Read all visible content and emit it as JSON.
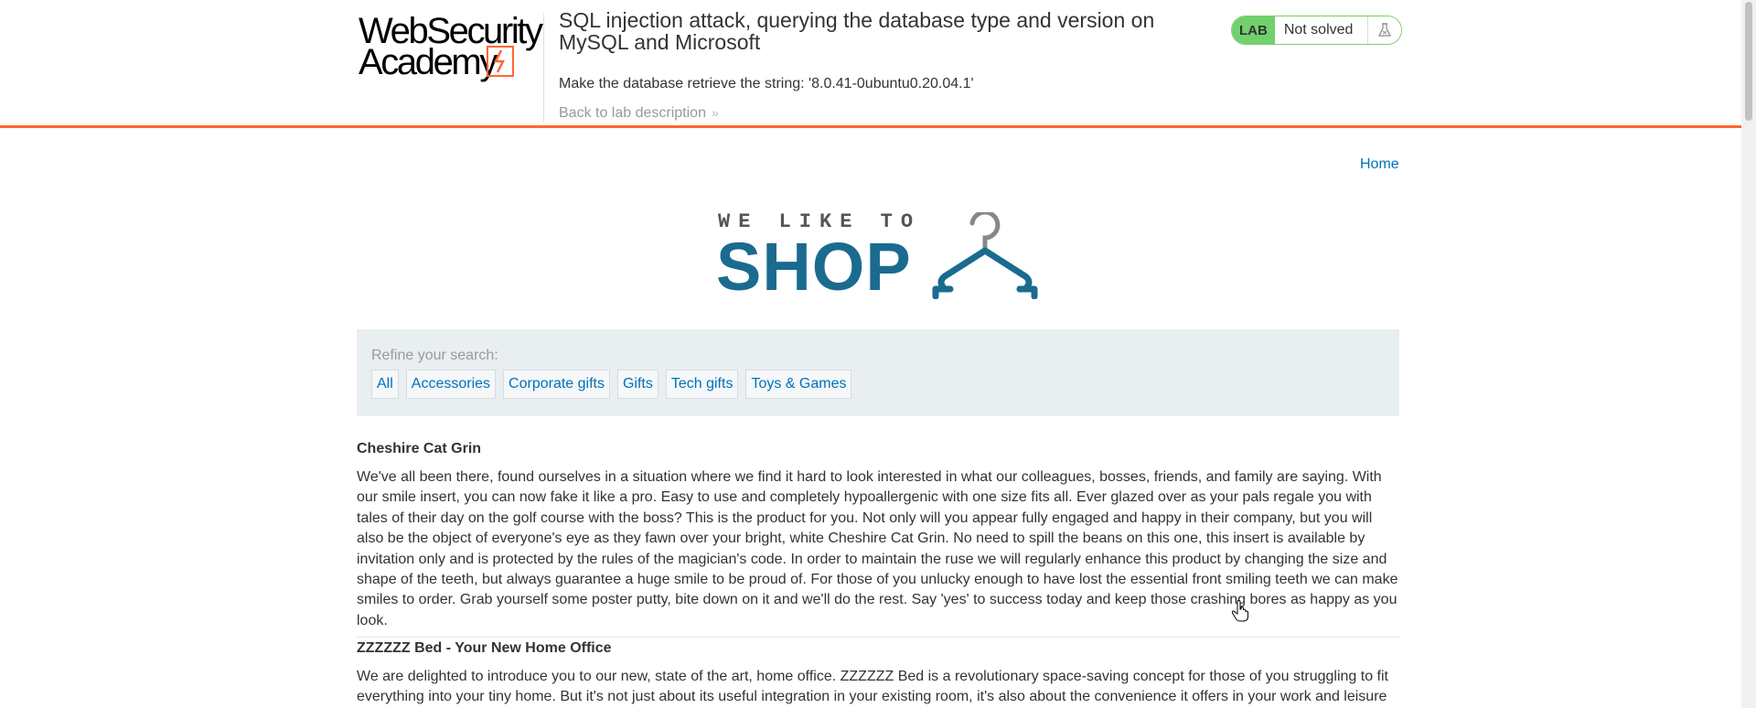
{
  "header": {
    "logo_line1": "WebSecurity",
    "logo_line2": "Academy",
    "lab_title": "SQL injection attack, querying the database type and version on MySQL and Microsoft",
    "lab_subtitle": "Make the database retrieve the string: '8.0.41-0ubuntu0.20.04.1'",
    "back_link": "Back to lab description",
    "status_badge": "LAB",
    "status_text": "Not solved",
    "colors": {
      "accent": "#ff6633",
      "badge": "#70d16d"
    }
  },
  "nav": {
    "home": "Home"
  },
  "shop_logo": {
    "tagline": "WE LIKE TO",
    "word": "SHOP"
  },
  "filters": {
    "label": "Refine your search:",
    "items": [
      "All",
      "Accessories",
      "Corporate gifts",
      "Gifts",
      "Tech gifts",
      "Toys & Games"
    ]
  },
  "products": [
    {
      "title": "Cheshire Cat Grin",
      "description": "We've all been there, found ourselves in a situation where we find it hard to look interested in what our colleagues, bosses, friends, and family are saying. With our smile insert, you can now fake it like a pro. Easy to use and completely hypoallergenic with one size fits all. Ever glazed over as your pals regale you with tales of their day on the golf course with the boss? This is the product for you. Not only will you appear fully engaged and happy in their company, but you will also be the object of everyone's eye as they fawn over your bright, white Cheshire Cat Grin. No need to spill the beans on this one, this insert is available by invitation only and is protected by the rules of the magician's code. In order to maintain the ruse we will regularly enhance this product by changing the size and shape of the teeth, but always guarantee a huge smile to be proud of. For those of you unlucky enough to have lost the essential front smiling teeth we can make smiles to order. Grab yourself some poster putty, bite down on it and we'll do the rest. Say 'yes' to success today and keep those crashing bores as happy as you look."
    },
    {
      "title": "ZZZZZZ Bed - Your New Home Office",
      "description": "We are delighted to introduce you to our new, state of the art, home office. ZZZZZZ Bed is a revolutionary space-saving concept for those of you struggling to fit everything into your tiny home. But it's not just about its useful integration in your existing room, it's also about the convenience it offers in your work and leisure"
    }
  ]
}
